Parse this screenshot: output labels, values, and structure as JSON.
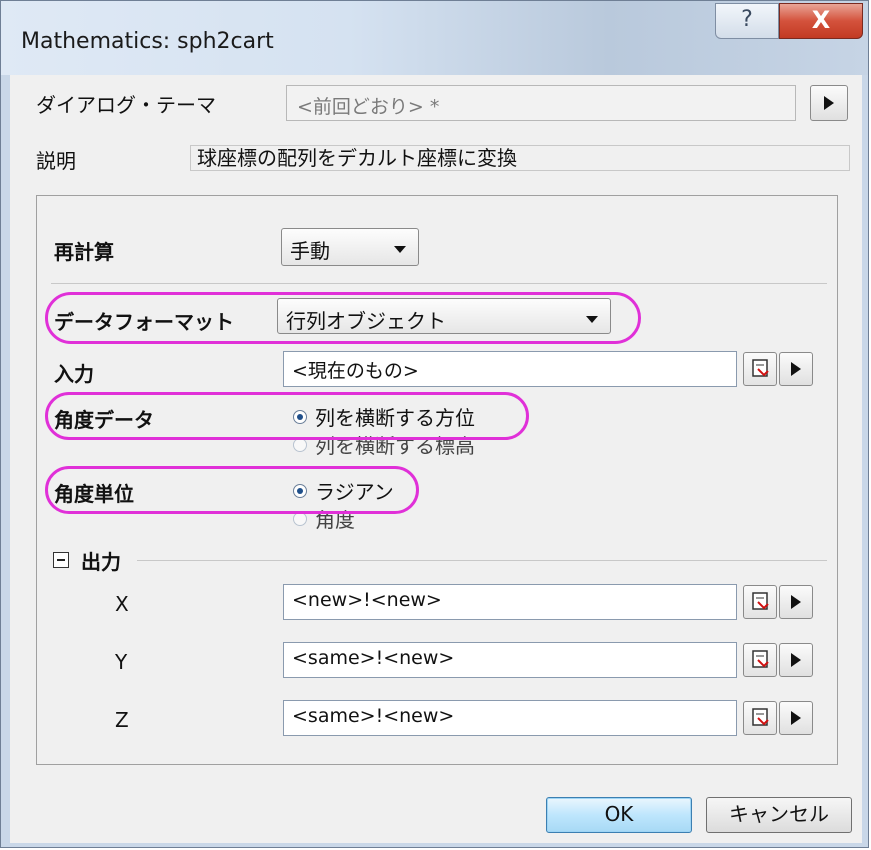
{
  "window": {
    "title": "Mathematics: sph2cart",
    "help_label": "?",
    "close_label": "X"
  },
  "dialog_theme": {
    "label": "ダイアログ・テーマ",
    "value": "<前回どおり> *"
  },
  "description": {
    "label": "説明",
    "value": "球座標の配列をデカルト座標に変換"
  },
  "recalc": {
    "label": "再計算",
    "value": "手動"
  },
  "data_format": {
    "label": "データフォーマット",
    "value": "行列オブジェクト"
  },
  "input": {
    "label": "入力",
    "value": "<現在のもの>"
  },
  "angle_data": {
    "label": "角度データ",
    "options": [
      "列を横断する方位",
      "列を横断する標高"
    ],
    "selected_index": 0
  },
  "angle_unit": {
    "label": "角度単位",
    "options": [
      "ラジアン",
      "角度"
    ],
    "selected_index": 0
  },
  "output": {
    "label": "出力",
    "collapse_symbol": "⊟",
    "rows": [
      {
        "label": "X",
        "value": "<new>!<new>"
      },
      {
        "label": "Y",
        "value": "<same>!<new>"
      },
      {
        "label": "Z",
        "value": "<same>!<new>"
      }
    ]
  },
  "buttons": {
    "ok": "OK",
    "cancel": "キャンセル"
  },
  "colors": {
    "highlight": "#e030d8",
    "ok_button": "#bee6fd",
    "close_button": "#c23a23"
  }
}
